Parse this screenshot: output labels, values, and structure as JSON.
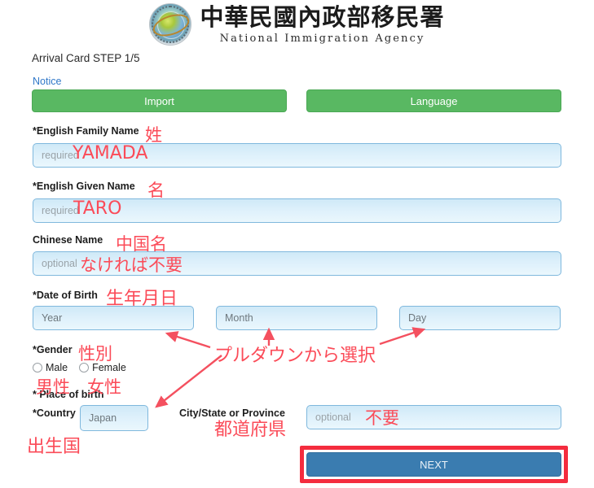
{
  "header": {
    "logo_name": "national-immigration-agency-emblem",
    "title_cn": "中華民國內政部移民署",
    "title_en": "National Immigration Agency"
  },
  "form": {
    "step_title": "Arrival Card STEP 1/5",
    "notice_label": "Notice",
    "import_label": "Import",
    "language_label": "Language",
    "next_label": "NEXT",
    "fields": {
      "family_name": {
        "label": "*English Family Name",
        "placeholder": "required"
      },
      "given_name": {
        "label": "*English Given Name",
        "placeholder": "required"
      },
      "chinese_name": {
        "label": "Chinese Name",
        "placeholder": "optional"
      },
      "date_of_birth": {
        "label": "*Date of Birth",
        "year_placeholder": "Year",
        "month_placeholder": "Month",
        "day_placeholder": "Day"
      },
      "gender": {
        "label": "*Gender",
        "options": [
          "Male",
          "Female"
        ]
      },
      "place_of_birth": {
        "label": "* Place of birth",
        "country_label": "*Country",
        "country_value": "Japan",
        "city_label": "City/State or Province",
        "city_placeholder": "optional"
      }
    }
  },
  "annotations": {
    "family_name_jp": "姓",
    "family_name_value": "YAMADA",
    "given_name_jp": "名",
    "given_name_value": "TARO",
    "chinese_name_jp": "中国名",
    "chinese_name_note": "なければ不要",
    "date_of_birth_jp": "生年月日",
    "pulldown_note": "プルダウンから選択",
    "gender_jp": "性別",
    "male_jp": "男性",
    "female_jp": "女性",
    "country_jp": "出生国",
    "city_jp": "都道府県",
    "city_note": "不要"
  },
  "colors": {
    "annotation_red": "#f4606c",
    "highlight_red": "#f42c3e",
    "green_button": "#59b862",
    "blue_button": "#3a7cb0",
    "link_blue": "#2f77c8",
    "input_border": "#7fb8dd"
  }
}
